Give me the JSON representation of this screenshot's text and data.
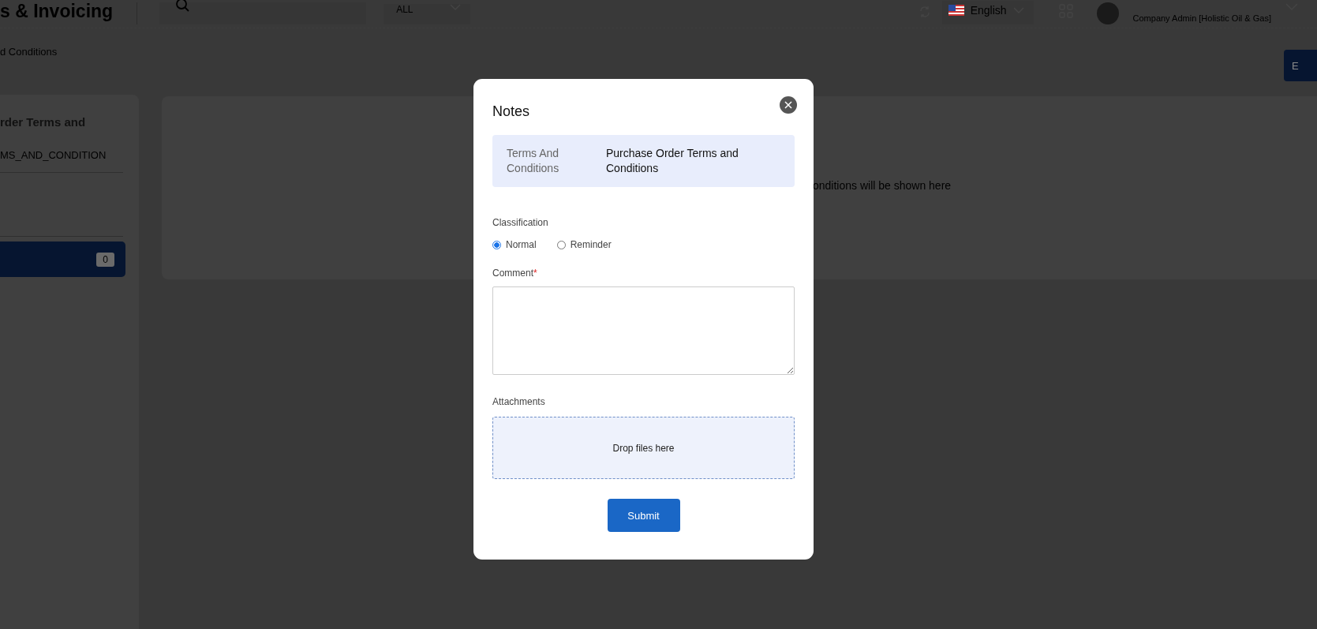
{
  "header": {
    "title": "s & Invoicing",
    "search": {
      "scope": "ALL"
    },
    "language": "English",
    "user_role": "Company Admin [Holistic Oil & Gas]"
  },
  "breadcrumb": "d Conditions",
  "top_button": "E",
  "sidebar": {
    "title": "rder Terms and",
    "code": "MS_AND_CONDITION",
    "items": [
      {
        "badge": "0",
        "selected": true
      }
    ]
  },
  "main": {
    "empty_message": "onditions will be shown here"
  },
  "modal": {
    "title": "Notes",
    "info": {
      "label": "Terms And Conditions",
      "value": "Purchase Order Terms and Conditions"
    },
    "classification": {
      "label": "Classification",
      "options": [
        {
          "label": "Normal",
          "selected": true
        },
        {
          "label": "Reminder",
          "selected": false
        }
      ]
    },
    "comment": {
      "label": "Comment",
      "required_mark": "*"
    },
    "attachments": {
      "label": "Attachments",
      "dropzone": "Drop files here"
    },
    "submit": "Submit"
  }
}
